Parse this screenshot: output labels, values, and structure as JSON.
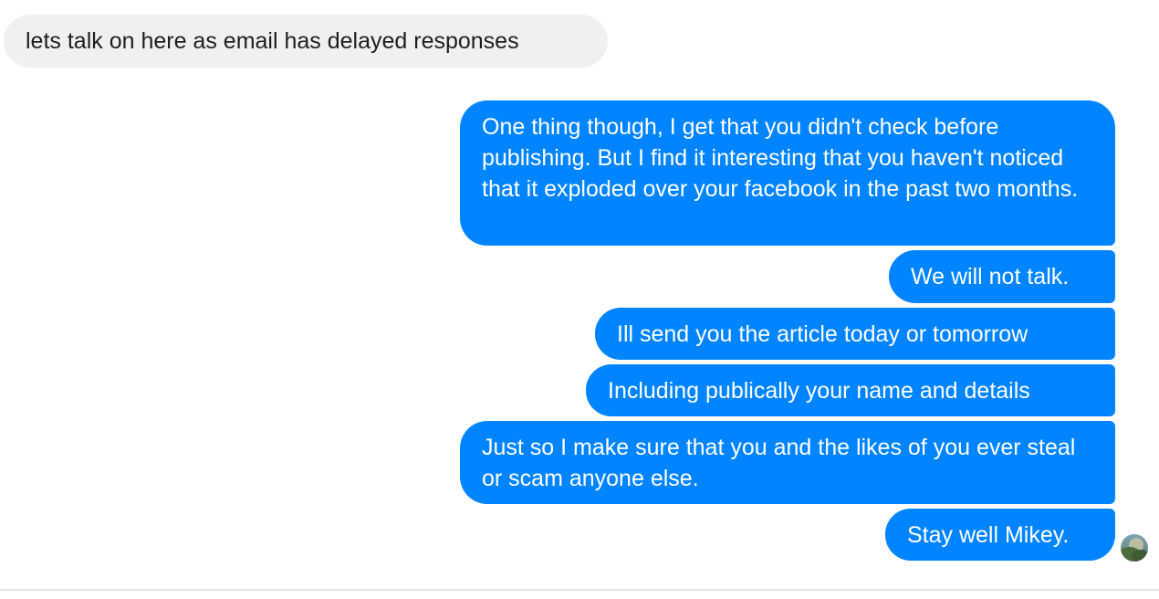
{
  "conversation": {
    "messages": [
      {
        "direction": "incoming",
        "text": "lets talk on here as email has delayed responses"
      },
      {
        "direction": "outgoing",
        "text": "One thing though, I get that you didn't check before publishing. But I find it interesting that you haven't noticed that it exploded over your facebook in the past two months."
      },
      {
        "direction": "outgoing",
        "text": "We will not talk."
      },
      {
        "direction": "outgoing",
        "text": "Ill send you the article today or tomorrow"
      },
      {
        "direction": "outgoing",
        "text": "Including publically your name and details"
      },
      {
        "direction": "outgoing",
        "text": "Just so I make sure that you and the likes of you ever steal or scam anyone else."
      },
      {
        "direction": "outgoing",
        "text": "Stay well Mikey."
      }
    ],
    "read_receipt_icon": "avatar-read-receipt-icon"
  },
  "colors": {
    "incoming_bubble": "#f1f0f0",
    "outgoing_bubble": "#0084ff",
    "outgoing_text": "#ffffff",
    "incoming_text": "#1c1e21"
  }
}
